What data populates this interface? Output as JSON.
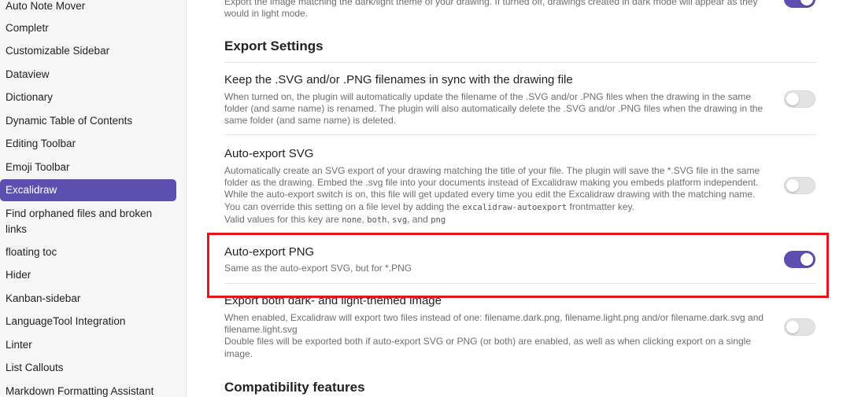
{
  "sidebar": {
    "items": [
      {
        "label": "Auto Note Mover"
      },
      {
        "label": "Completr"
      },
      {
        "label": "Customizable Sidebar"
      },
      {
        "label": "Dataview"
      },
      {
        "label": "Dictionary"
      },
      {
        "label": "Dynamic Table of Contents"
      },
      {
        "label": "Editing Toolbar"
      },
      {
        "label": "Emoji Toolbar"
      },
      {
        "label": "Excalidraw"
      },
      {
        "label": "Find orphaned files and broken links"
      },
      {
        "label": "floating toc"
      },
      {
        "label": "Hider"
      },
      {
        "label": "Kanban-sidebar"
      },
      {
        "label": "LanguageTool Integration"
      },
      {
        "label": "Linter"
      },
      {
        "label": "List Callouts"
      },
      {
        "label": "Markdown Formatting Assistant"
      }
    ]
  },
  "main": {
    "top_desc": "Export the image matching the dark/light theme of your drawing. If turned off, drawings created in dark mode will appear as they would in light mode.",
    "export_heading": "Export Settings",
    "sync": {
      "title": "Keep the .SVG and/or .PNG filenames in sync with the drawing file",
      "desc": "When turned on, the plugin will automatically update the filename of the .SVG and/or .PNG files when the drawing in the same folder (and same name) is renamed. The plugin will also automatically delete the .SVG and/or .PNG files when the drawing in the same folder (and same name) is deleted."
    },
    "svg": {
      "title": "Auto-export SVG",
      "desc_1": "Automatically create an SVG export of your drawing matching the title of your file. The plugin will save the *.SVG file in the same folder as the drawing. Embed the .svg file into your documents instead of Excalidraw making you embeds platform independent. While the auto-export switch is on, this file will get updated every time you edit the Excalidraw drawing with the matching name. You can override this setting on a file level by adding the",
      "code_key": "excalidraw-autoexport",
      "desc_2": "frontmatter key.",
      "desc_3": "Valid values for this key are",
      "code_none": "none",
      "sep1": ",",
      "code_both": "both",
      "sep2": ",",
      "code_svg": "svg",
      "sep3": ", and",
      "code_png": "png"
    },
    "png": {
      "title": "Auto-export PNG",
      "desc": "Same as the auto-export SVG, but for *.PNG"
    },
    "both": {
      "title": "Export both dark- and light-themed image",
      "desc_1": "When enabled, Excalidraw will export two files instead of one: filename.dark.png, filename.light.png and/or filename.dark.svg and filename.light.svg",
      "desc_2": "Double files will be exported both if auto-export SVG or PNG (or both) are enabled, as well as when clicking export on a single image."
    },
    "compat_heading": "Compatibility features"
  },
  "toggles": {
    "top": true,
    "sync": false,
    "svg": false,
    "png": true,
    "both": false
  },
  "colors": {
    "accent": "#5c4fb0",
    "highlight": "#e8141b"
  }
}
